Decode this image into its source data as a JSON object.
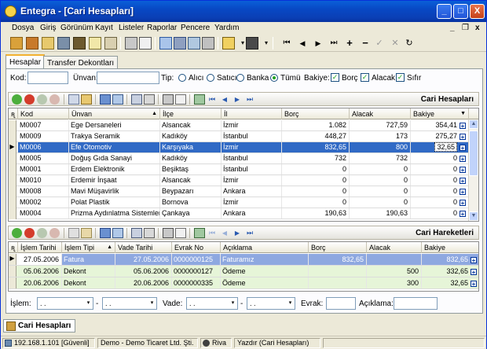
{
  "window": {
    "title": "Entegra - [Cari Hesapları]",
    "minimize": "_",
    "maximize": "□",
    "close": "X"
  },
  "menu": [
    {
      "label": "Dosya"
    },
    {
      "label": "Giriş"
    },
    {
      "label": "Görünüm"
    },
    {
      "label": "Kayıt"
    },
    {
      "label": "Listeler"
    },
    {
      "label": "Raporlar"
    },
    {
      "label": "Pencere"
    },
    {
      "label": "Yardım"
    }
  ],
  "mdi": {
    "minimize": "_",
    "restore": "❐",
    "close": "x"
  },
  "tabs": [
    {
      "label": "Hesaplar"
    },
    {
      "label": "Transfer Dekontları"
    }
  ],
  "filters": {
    "kod_label": "Kod:",
    "unvan_label": "Ünvan:",
    "tip_label": "Tip:",
    "tip_options": [
      "Alıcı",
      "Satıcı",
      "Banka",
      "Tümü"
    ],
    "tip_selected": "Tümü",
    "bakiye_label": "Bakiye:",
    "bakiye_options": [
      "Borç",
      "Alacak",
      "Sıfır"
    ]
  },
  "cari_hesaplari": {
    "title": "Cari Hesapları",
    "columns": [
      "Kod",
      "Ünvan",
      "İlçe",
      "İl",
      "Borç",
      "Alacak",
      "Bakiye"
    ],
    "rows": [
      {
        "kod": "M0007",
        "unvan": "Ege Dersaneleri",
        "ilce": "Alsancak",
        "il": "İzmir",
        "borc": "1.082",
        "alacak": "727,59",
        "bakiye": "354,41"
      },
      {
        "kod": "M0009",
        "unvan": "Trakya Seramik",
        "ilce": "Kadıköy",
        "il": "İstanbul",
        "borc": "448,27",
        "alacak": "173",
        "bakiye": "275,27"
      },
      {
        "kod": "M0006",
        "unvan": "Efe Otomotiv",
        "ilce": "Karşıyaka",
        "il": "İzmir",
        "borc": "832,65",
        "alacak": "800",
        "bakiye": "32,65"
      },
      {
        "kod": "M0005",
        "unvan": "Doğuş Gıda Sanayi",
        "ilce": "Kadıköy",
        "il": "İstanbul",
        "borc": "732",
        "alacak": "732",
        "bakiye": "0"
      },
      {
        "kod": "M0001",
        "unvan": "Erdem Elektronik",
        "ilce": "Beşiktaş",
        "il": "İstanbul",
        "borc": "0",
        "alacak": "0",
        "bakiye": "0"
      },
      {
        "kod": "M0010",
        "unvan": "Erdemir İnşaat",
        "ilce": "Alsancak",
        "il": "İzmir",
        "borc": "0",
        "alacak": "0",
        "bakiye": "0"
      },
      {
        "kod": "M0008",
        "unvan": "Mavi Müşavirlik",
        "ilce": "Beypazarı",
        "il": "Ankara",
        "borc": "0",
        "alacak": "0",
        "bakiye": "0"
      },
      {
        "kod": "M0002",
        "unvan": "Polat Plastik",
        "ilce": "Bornova",
        "il": "İzmir",
        "borc": "0",
        "alacak": "0",
        "bakiye": "0"
      },
      {
        "kod": "M0004",
        "unvan": "Prizma Aydınlatma Sistemleri",
        "ilce": "Çankaya",
        "il": "Ankara",
        "borc": "190,63",
        "alacak": "190,63",
        "bakiye": "0"
      }
    ],
    "selected_index": 2
  },
  "cari_hareketleri": {
    "title": "Cari Hareketleri",
    "columns": [
      "İşlem Tarihi",
      "İşlem Tipi",
      "Vade Tarihi",
      "Evrak No",
      "Açıklama",
      "Borç",
      "Alacak",
      "Bakiye"
    ],
    "rows": [
      {
        "islem_tarihi": "27.05.2006",
        "islem_tipi": "Fatura",
        "vade_tarihi": "27.05.2006",
        "evrak_no": "0000000125",
        "aciklama": "Faturamız",
        "borc": "832,65",
        "alacak": "",
        "bakiye": "832,65"
      },
      {
        "islem_tarihi": "05.06.2006",
        "islem_tipi": "Dekont",
        "vade_tarihi": "05.06.2006",
        "evrak_no": "0000000127",
        "aciklama": "Ödeme",
        "borc": "",
        "alacak": "500",
        "bakiye": "332,65"
      },
      {
        "islem_tarihi": "20.06.2006",
        "islem_tipi": "Dekont",
        "vade_tarihi": "20.06.2006",
        "evrak_no": "0000000335",
        "aciklama": "Ödeme",
        "borc": "",
        "alacak": "300",
        "bakiye": "32,65"
      }
    ],
    "selected_index": 0
  },
  "bottom_filters": {
    "islem_label": "İşlem:",
    "vade_label": "Vade:",
    "evrak_label": "Evrak:",
    "aciklama_label": "Açıklama:",
    "date_placeholder": ". ."
  },
  "doc_tab": "Cari Hesapları",
  "status": {
    "ip": "192.168.1.101 [Güvenli]",
    "company": "Demo - Demo Ticaret Ltd. Şti.",
    "user": "Riva",
    "mode": "Yazdır (Cari Hesapları)"
  },
  "colors": {
    "selection": "#316ac5",
    "row_highlight_green": "#e6f5d8",
    "title_bar": "#0a5fd8"
  }
}
